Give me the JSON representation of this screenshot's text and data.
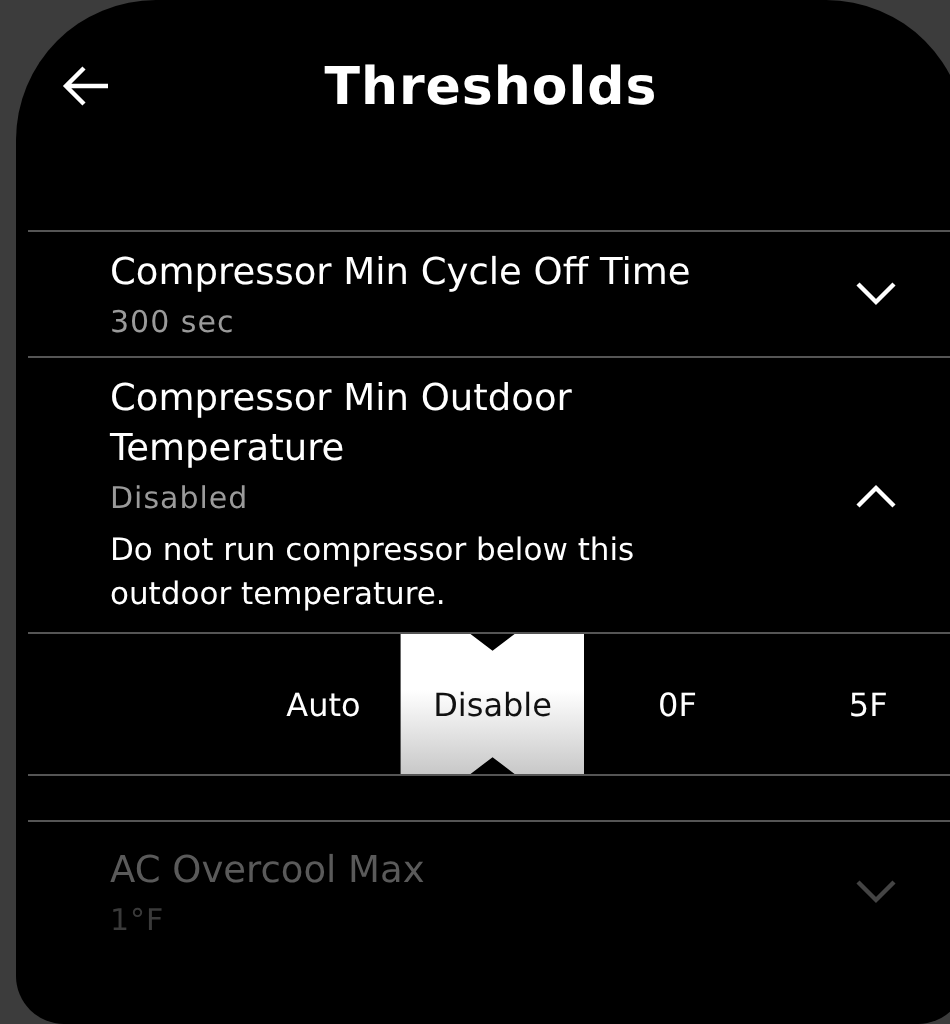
{
  "header": {
    "title": "Thresholds"
  },
  "settings": [
    {
      "title": "Compressor Min Cycle Off Time",
      "value": "300 sec",
      "expanded": false
    },
    {
      "title": "Compressor Min Outdoor Temperature",
      "value": "Disabled",
      "expanded": true,
      "description": "Do not run compressor below this outdoor temperature.",
      "options": [
        {
          "label": "Auto",
          "selected": false
        },
        {
          "label": "Disable",
          "selected": true
        },
        {
          "label": "0F",
          "selected": false
        },
        {
          "label": "5F",
          "selected": false
        }
      ]
    },
    {
      "title": "AC Overcool Max",
      "value": "1°F",
      "expanded": false
    }
  ]
}
